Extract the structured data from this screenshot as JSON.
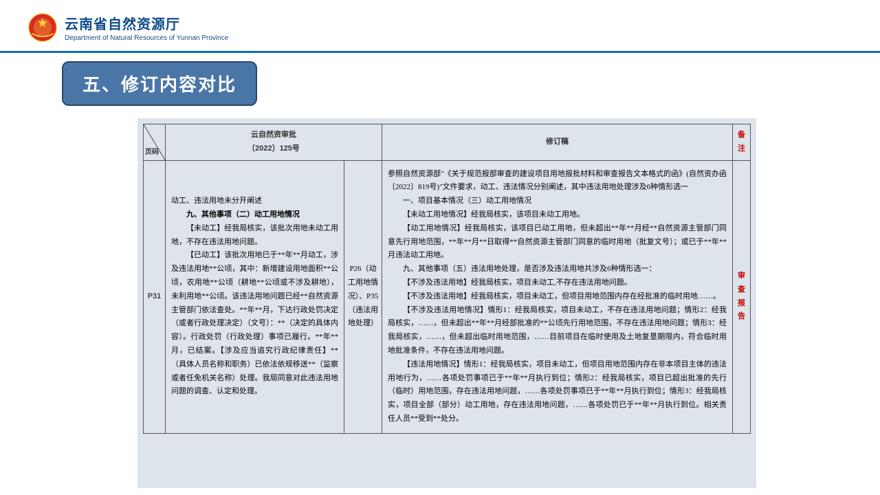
{
  "header": {
    "title": "云南省自然资源厅",
    "subtitle": "Department of Natural Resources of Yunnan Province"
  },
  "section_heading": "五、修订内容对比",
  "table": {
    "head": {
      "corner_label": "页码",
      "original_ref": "云自然资审批\n〔2022〕125号",
      "revision": "修订稿",
      "remark": "备注"
    },
    "row": {
      "page": "P31",
      "original": "动工、违法用地未分开阐述\n　　九、其他事项（二）动工用地情况\n　　【未动工】经我局核实，该批次用地未动工用地，不存在违法用地问题。\n　　【已动工】该批次用地已于**年**月动工，涉及违法用地**公顷，其中：新增建设用地面积**公顷，农用地**公顷（耕地**公顷或不涉及耕地），未利用地**公顷。该违法用地问题已经**自然资源主管部门依法查处。**年**月，下达行政处罚决定（或者行政处理决定）（文号）：**（决定的具体内容）。行政处罚（行政处理）事项已履行。**年**月，已结案。【涉及应当追究行政纪律责任】**（具体人员名称和职务）已依法依规移送**（监察或者任免机关名称）处理。我局同意对此违法用地问题的调查、认定和处理。",
      "mid": "P26（动工用地情况）、P35（违法用地处理）",
      "revision": "参照自然资源部\"《关于规范报部审查的建设项目用地报批材料和审查报告文本格式的函》(自然资办函〔2022〕819号)\"文件要求，动工、违法情况分别阐述，其中违法用地处理涉及6种情形选一\n　　一、项目基本情况（三）动工用地情况\n　　【未动工用地情况】经我局核实，该项目未动工用地。\n　　【动工用地情况】经我局核实，该项目已动工用地，但未超出**年**月经**自然资源主管部门同意先行用地范围，**年**月**日取得**自然资源主管部门同意的临时用地（批复文号）；或已于**年**月违法动工用地。\n　　九、其他事项（五）违法用地处理，是否涉及违法用地共涉及6种情形选一：\n　　【不涉及违法用地】经我局核实，项目未动工,不存在违法用地问题。\n　　【不涉及违法用地】经我局核实，项目未动工，但项目用地范围内存在经批准的临时用地……。\n　　【不涉及违法用地情况】情形1：经我局核实，项目未动工，不存在违法用地问题；情形2：经我局核实，……，但未超出**年**月经部批准的**公顷先行用地范围，不存在违法用地问题；情形3：经我局核实，……，但未超出临时用地范围，……目前项目在临时使用及土地复垦期限内，符合临时用地批准条件，不存在违法用地问题。\n　　【违法用地情况】情形1：经我局核实，项目未动工，但项目用地范围内存在非本项目主体的违法用地行为，……各项处罚事项已于**年**月执行到位；情形2：经我局核实，项目已超出批准的先行（临时）用地范围，存在违法用地问题，……各项处罚事项已于**年**月执行到位；情形3：经我局核实，项目全部（部分）动工用地，存在违法用地问题，……各项处罚已于**年**月执行到位。相关责任人员**受到**处分。",
      "remark": "审查报告"
    }
  }
}
